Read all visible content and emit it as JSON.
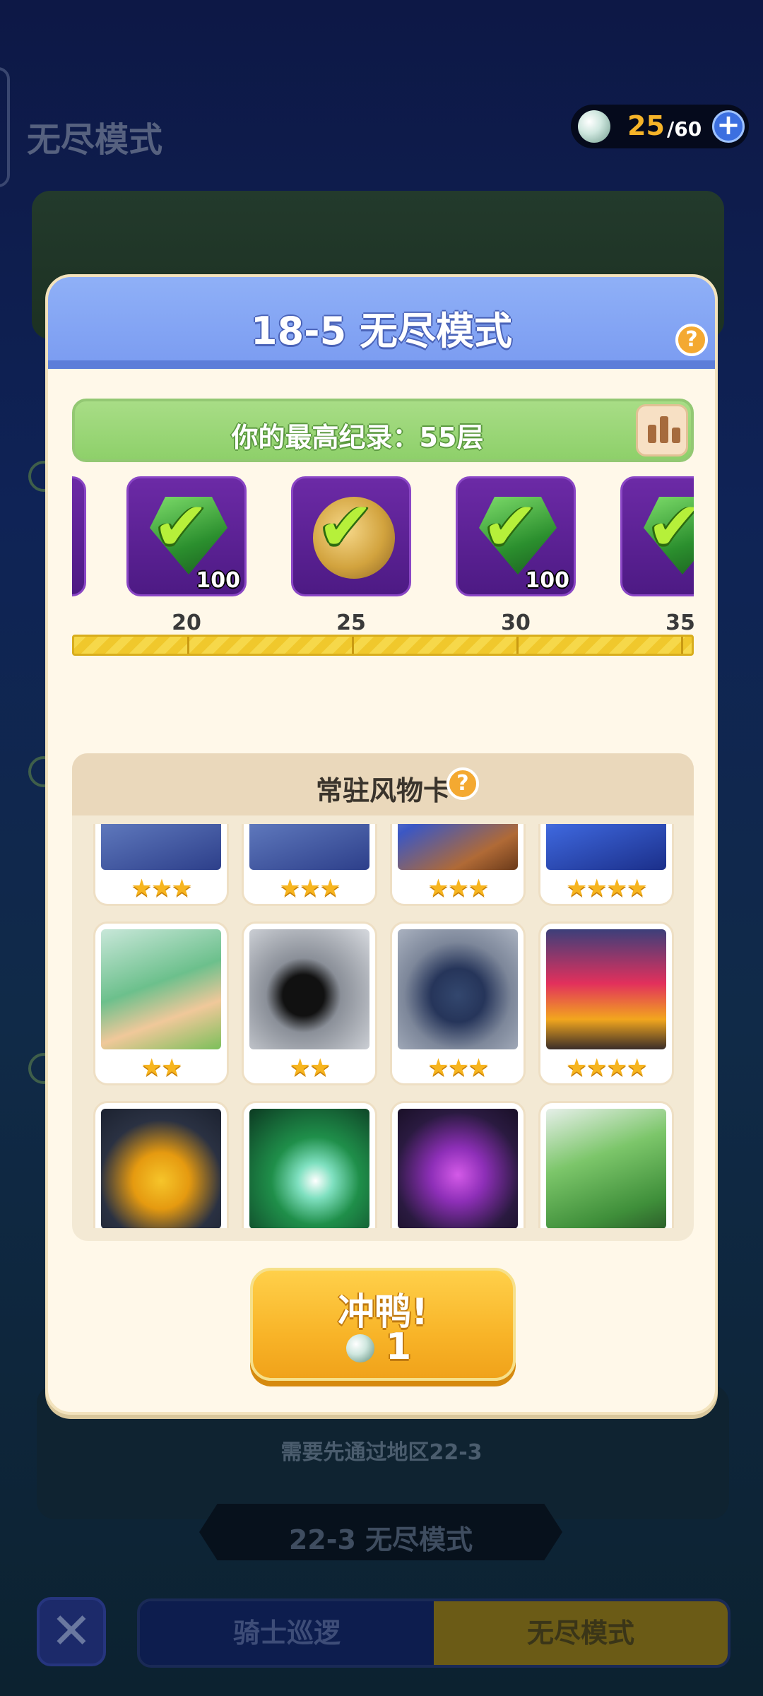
{
  "background": {
    "title": "无尽模式",
    "locked_note": "需要先通过地区22-3",
    "locked_stage": "22-3 无尽模式",
    "tabs": [
      {
        "label": "骑士巡逻",
        "active": false
      },
      {
        "label": "无尽模式",
        "active": true
      }
    ],
    "close_icon": "close-x-icon"
  },
  "currency": {
    "icon": "energy-gem-icon",
    "current": "25",
    "max": "/60",
    "add_icon": "plus-icon"
  },
  "modal": {
    "title": "18-5 无尽模式",
    "help_icon": "question-icon",
    "record": {
      "text": "你的最高纪录：55层",
      "chart_icon": "leaderboard-chart-icon"
    },
    "milestones": [
      {
        "label": "20",
        "reward": "green-gem-icon",
        "qty": "100",
        "claimed": true
      },
      {
        "label": "25",
        "reward": "gold-coin-icon",
        "qty": "",
        "claimed": true
      },
      {
        "label": "30",
        "reward": "green-gem-icon",
        "qty": "100",
        "claimed": true
      },
      {
        "label": "35",
        "reward": "green-gem-icon",
        "qty": "",
        "claimed": true
      }
    ],
    "progress_fraction": 1.0,
    "relics": {
      "title": "常驻风物卡",
      "cards": [
        {
          "art": "robot-mech-art",
          "stars": "★★★"
        },
        {
          "art": "robot-mech-art",
          "stars": "★★★"
        },
        {
          "art": "sword-fist-art",
          "stars": "★★★"
        },
        {
          "art": "blue-lightning-art",
          "stars": "★★★★"
        },
        {
          "art": "green-hair-girl-art",
          "stars": "★★"
        },
        {
          "art": "shadow-runner-art",
          "stars": "★★"
        },
        {
          "art": "missile-fish-art",
          "stars": "★★★"
        },
        {
          "art": "red-beam-art",
          "stars": "★★★★"
        },
        {
          "art": "yellow-chicks-art",
          "stars": ""
        },
        {
          "art": "green-burst-art",
          "stars": ""
        },
        {
          "art": "purple-monster-art",
          "stars": ""
        },
        {
          "art": "green-book-art",
          "stars": ""
        }
      ]
    },
    "go_button": {
      "label": "冲鸭!",
      "cost": "1",
      "cost_icon": "energy-gem-icon"
    }
  }
}
